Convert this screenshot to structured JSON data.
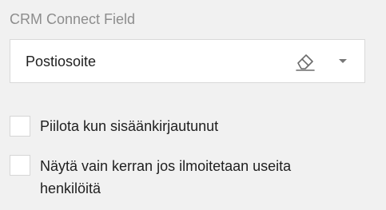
{
  "field": {
    "label": "CRM Connect Field",
    "selected_value": "Postiosoite",
    "clear_icon": "eraser-icon",
    "dropdown_icon": "chevron-down-icon"
  },
  "options": [
    {
      "label": "Piilota kun sisäänkirjautunut",
      "checked": false
    },
    {
      "label": "Näytä vain kerran jos ilmoitetaan useita henkilöitä",
      "checked": false
    }
  ],
  "colors": {
    "background": "#f1f1f1",
    "label_gray": "#8d8d8d",
    "text": "#1f1f1f",
    "border": "#d9d9d9"
  }
}
